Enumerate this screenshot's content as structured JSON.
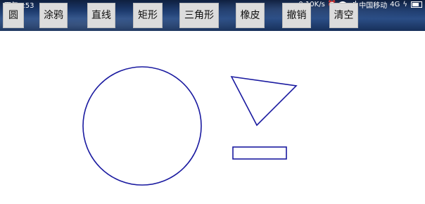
{
  "status_bar": {
    "time": "下午1:53",
    "speed": "0.10K/s",
    "carrier": "中国移动",
    "network": "4G"
  },
  "toolbar": {
    "buttons": [
      "圆",
      "涂鸦",
      "直线",
      "矩形",
      "三角形",
      "橡皮",
      "撤销",
      "清空"
    ]
  },
  "drawing": {
    "stroke_color": "#1a1aa0",
    "shapes": [
      "circle",
      "triangle",
      "rectangle"
    ]
  }
}
